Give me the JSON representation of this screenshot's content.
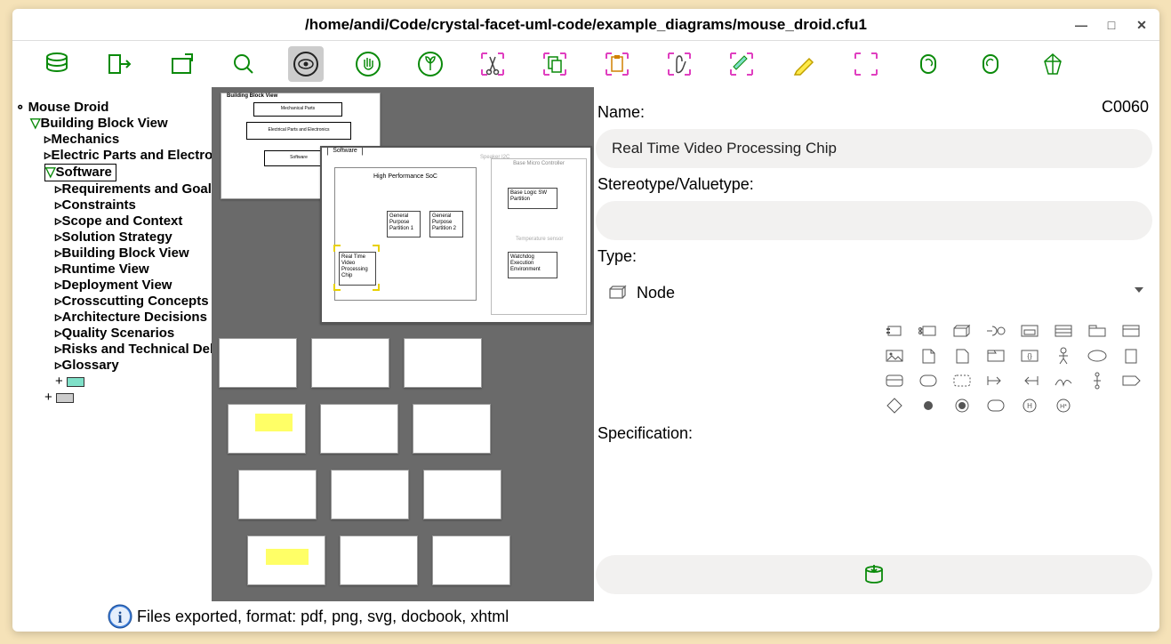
{
  "window": {
    "title": "/home/andi/Code/crystal-facet-uml-code/example_diagrams/mouse_droid.cfu1"
  },
  "tree": {
    "root": "Mouse Droid",
    "l1": "Building Block View",
    "items": [
      "Mechanics",
      "Electric Parts and Electronics",
      "Software",
      "Requirements and Goals",
      "Constraints",
      "Scope and Context",
      "Solution Strategy",
      "Building Block View",
      "Runtime View",
      "Deployment View",
      "Crosscutting Concepts",
      "Architecture Decisions",
      "Quality Scenarios",
      "Risks and Technical Debts",
      "Glossary"
    ],
    "selected_index": 2
  },
  "diagram": {
    "top_stack_title": "Building Block View",
    "top_stack_sub1": "Mechanical Parts",
    "top_stack_sub2": "Electrical Parts and Electronics",
    "top_stack_sub3": "Software",
    "main_tab": "Software",
    "main_title": "High Performance SoC",
    "blocks": {
      "gp1": "General\nPurpose\nPartition 1",
      "gp2": "General\nPurpose\nPartition 2",
      "rtv": "Real Time\nVideo\nProcessing\nChip",
      "blsw": "Base Logic SW\nPartition",
      "wde": "Watchdog\nExecution\nEnvironment",
      "bmc": "Base Micro Controller",
      "spk": "Speaker I2C",
      "temp": "Temperature sensor"
    }
  },
  "props": {
    "id": "C0060",
    "name_label": "Name:",
    "name_value": "Real Time Video Processing Chip",
    "stereo_label": "Stereotype/Valuetype:",
    "stereo_value": "",
    "type_label": "Type:",
    "type_value": "Node",
    "spec_label": "Specification:"
  },
  "status": {
    "message": "Files exported, format: pdf, png, svg, docbook, xhtml"
  }
}
